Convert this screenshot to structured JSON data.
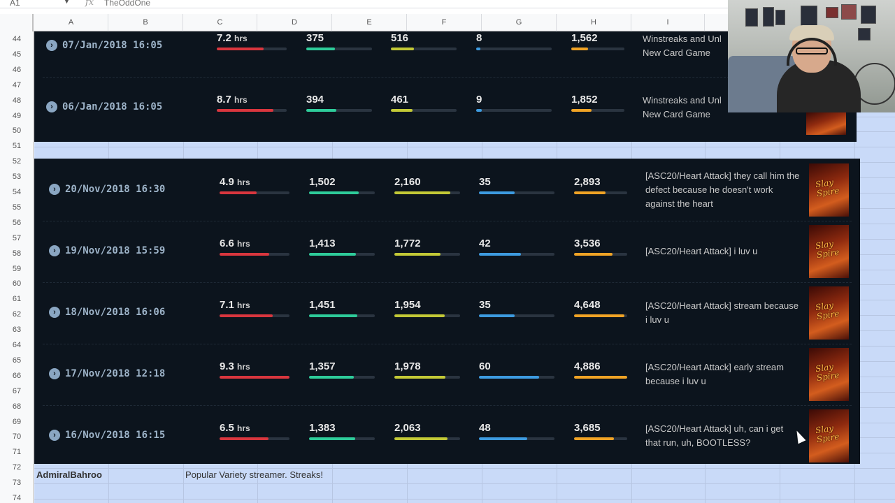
{
  "formula_bar": {
    "cell_ref": "A1",
    "fx": "fx",
    "value": "TheOddOne"
  },
  "columns": [
    "A",
    "B",
    "C",
    "D",
    "E",
    "F",
    "G",
    "H",
    "I"
  ],
  "rows": [
    "44",
    "45",
    "46",
    "47",
    "48",
    "49",
    "50",
    "51",
    "52",
    "53",
    "54",
    "55",
    "56",
    "57",
    "58",
    "59",
    "60",
    "61",
    "62",
    "63",
    "64",
    "65",
    "66",
    "67",
    "68",
    "69",
    "70",
    "71",
    "72",
    "73",
    "74"
  ],
  "panel1": {
    "entries": [
      {
        "date": "07/Jan/2018 16:05",
        "hours": "7.2",
        "unit": "hrs",
        "v1": "375",
        "v2": "516",
        "v3": "8",
        "v4": "1,562",
        "title": "Winstreaks and Unl\nNew Card Game",
        "fills": [
          0.67,
          0.44,
          0.35,
          0.06,
          0.32
        ]
      },
      {
        "date": "06/Jan/2018 16:05",
        "hours": "8.7",
        "unit": "hrs",
        "v1": "394",
        "v2": "461",
        "v3": "9",
        "v4": "1,852",
        "title": "Winstreaks and Unl\nNew Card Game",
        "fills": [
          0.81,
          0.46,
          0.33,
          0.07,
          0.38
        ]
      }
    ]
  },
  "panel2": {
    "thumb_text": "Slay\nSpire",
    "entries": [
      {
        "date": "20/Nov/2018 16:30",
        "hours": "4.9",
        "unit": "hrs",
        "v1": "1,502",
        "v2": "2,160",
        "v3": "35",
        "v4": "2,893",
        "title": "[ASC20/Heart Attack] they call him the defect because he doesn't work against the heart",
        "fills": [
          0.53,
          0.76,
          0.85,
          0.47,
          0.59
        ]
      },
      {
        "date": "19/Nov/2018 15:59",
        "hours": "6.6",
        "unit": "hrs",
        "v1": "1,413",
        "v2": "1,772",
        "v3": "42",
        "v4": "3,536",
        "title": "[ASC20/Heart Attack] i luv u",
        "fills": [
          0.71,
          0.71,
          0.7,
          0.56,
          0.72
        ]
      },
      {
        "date": "18/Nov/2018 16:06",
        "hours": "7.1",
        "unit": "hrs",
        "v1": "1,451",
        "v2": "1,954",
        "v3": "35",
        "v4": "4,648",
        "title": "[ASC20/Heart Attack] stream because i luv u",
        "fills": [
          0.76,
          0.73,
          0.77,
          0.47,
          0.95
        ]
      },
      {
        "date": "17/Nov/2018 12:18",
        "hours": "9.3",
        "unit": "hrs",
        "v1": "1,357",
        "v2": "1,978",
        "v3": "60",
        "v4": "4,886",
        "title": "[ASC20/Heart Attack] early stream because i luv u",
        "fills": [
          1.0,
          0.68,
          0.78,
          0.8,
          1.0
        ]
      },
      {
        "date": "16/Nov/2018 16:15",
        "hours": "6.5",
        "unit": "hrs",
        "v1": "1,383",
        "v2": "2,063",
        "v3": "48",
        "v4": "3,685",
        "title": "[ASC20/Heart Attack] uh, can i get that run, uh, BOOTLESS?",
        "fills": [
          0.7,
          0.7,
          0.81,
          0.64,
          0.75
        ]
      }
    ]
  },
  "streamer": {
    "name": "AdmiralBahroo",
    "description": "Popular Variety streamer. Streaks!"
  },
  "colors": {
    "hours": "#d9363e",
    "v1": "#2ecc9a",
    "v2": "#c3c936",
    "v3": "#3d9be0",
    "v4": "#f0a325",
    "panel": "#0c141d",
    "sheet_fill": "#c9daf8"
  }
}
